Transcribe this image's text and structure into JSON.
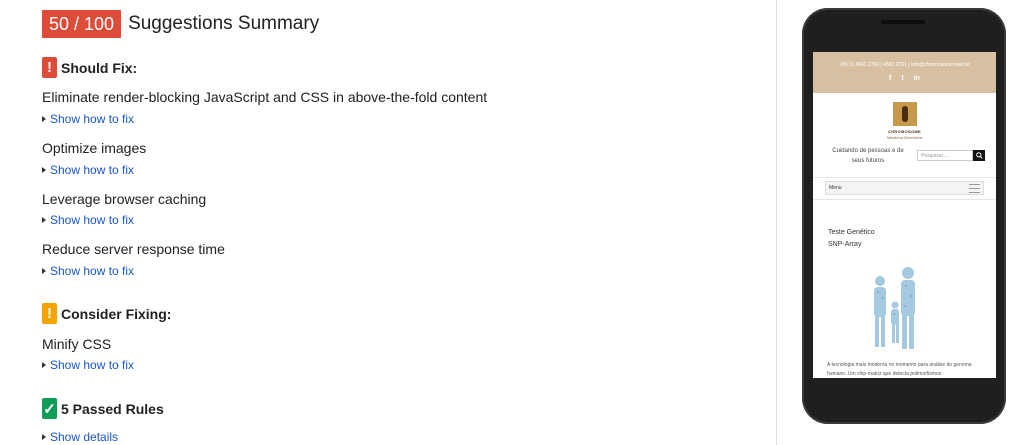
{
  "score": "50 / 100",
  "summary_title": "Suggestions Summary",
  "should_fix": {
    "label": "Should Fix:",
    "rules": [
      "Eliminate render-blocking JavaScript and CSS in above-the-fold content",
      "Optimize images",
      "Leverage browser caching",
      "Reduce server response time"
    ]
  },
  "consider_fixing": {
    "label": "Consider Fixing:",
    "rules": [
      "Minify CSS"
    ]
  },
  "passed": {
    "label": "5 Passed Rules",
    "link": "Show details"
  },
  "show_how": "Show how to fix",
  "badges": {
    "exclaim": "!",
    "check": "✓"
  },
  "colors": {
    "score_bg": "#dd4b39",
    "warn": "#f4a300",
    "pass": "#0f9d58",
    "link": "#1a56c8"
  },
  "phone_site": {
    "contact": "+55 11 4561 2760 | 4561 2761  |  info@chromosome.med.br",
    "social": [
      "f",
      "t",
      "in"
    ],
    "brand": "CHROMOSOME",
    "brand_sub": "Medicina Genômica",
    "tagline": "Cuidando de pessoas e de seus futuros",
    "search_placeholder": "Pesquisar ...",
    "menu": "Menu",
    "title_line1": "Teste Genético",
    "title_line2": "SNP-Array",
    "paragraph": "A tecnologia mais moderna no momento para análise do genoma humano. Um chip-matriz que detecta polimorfismos"
  }
}
